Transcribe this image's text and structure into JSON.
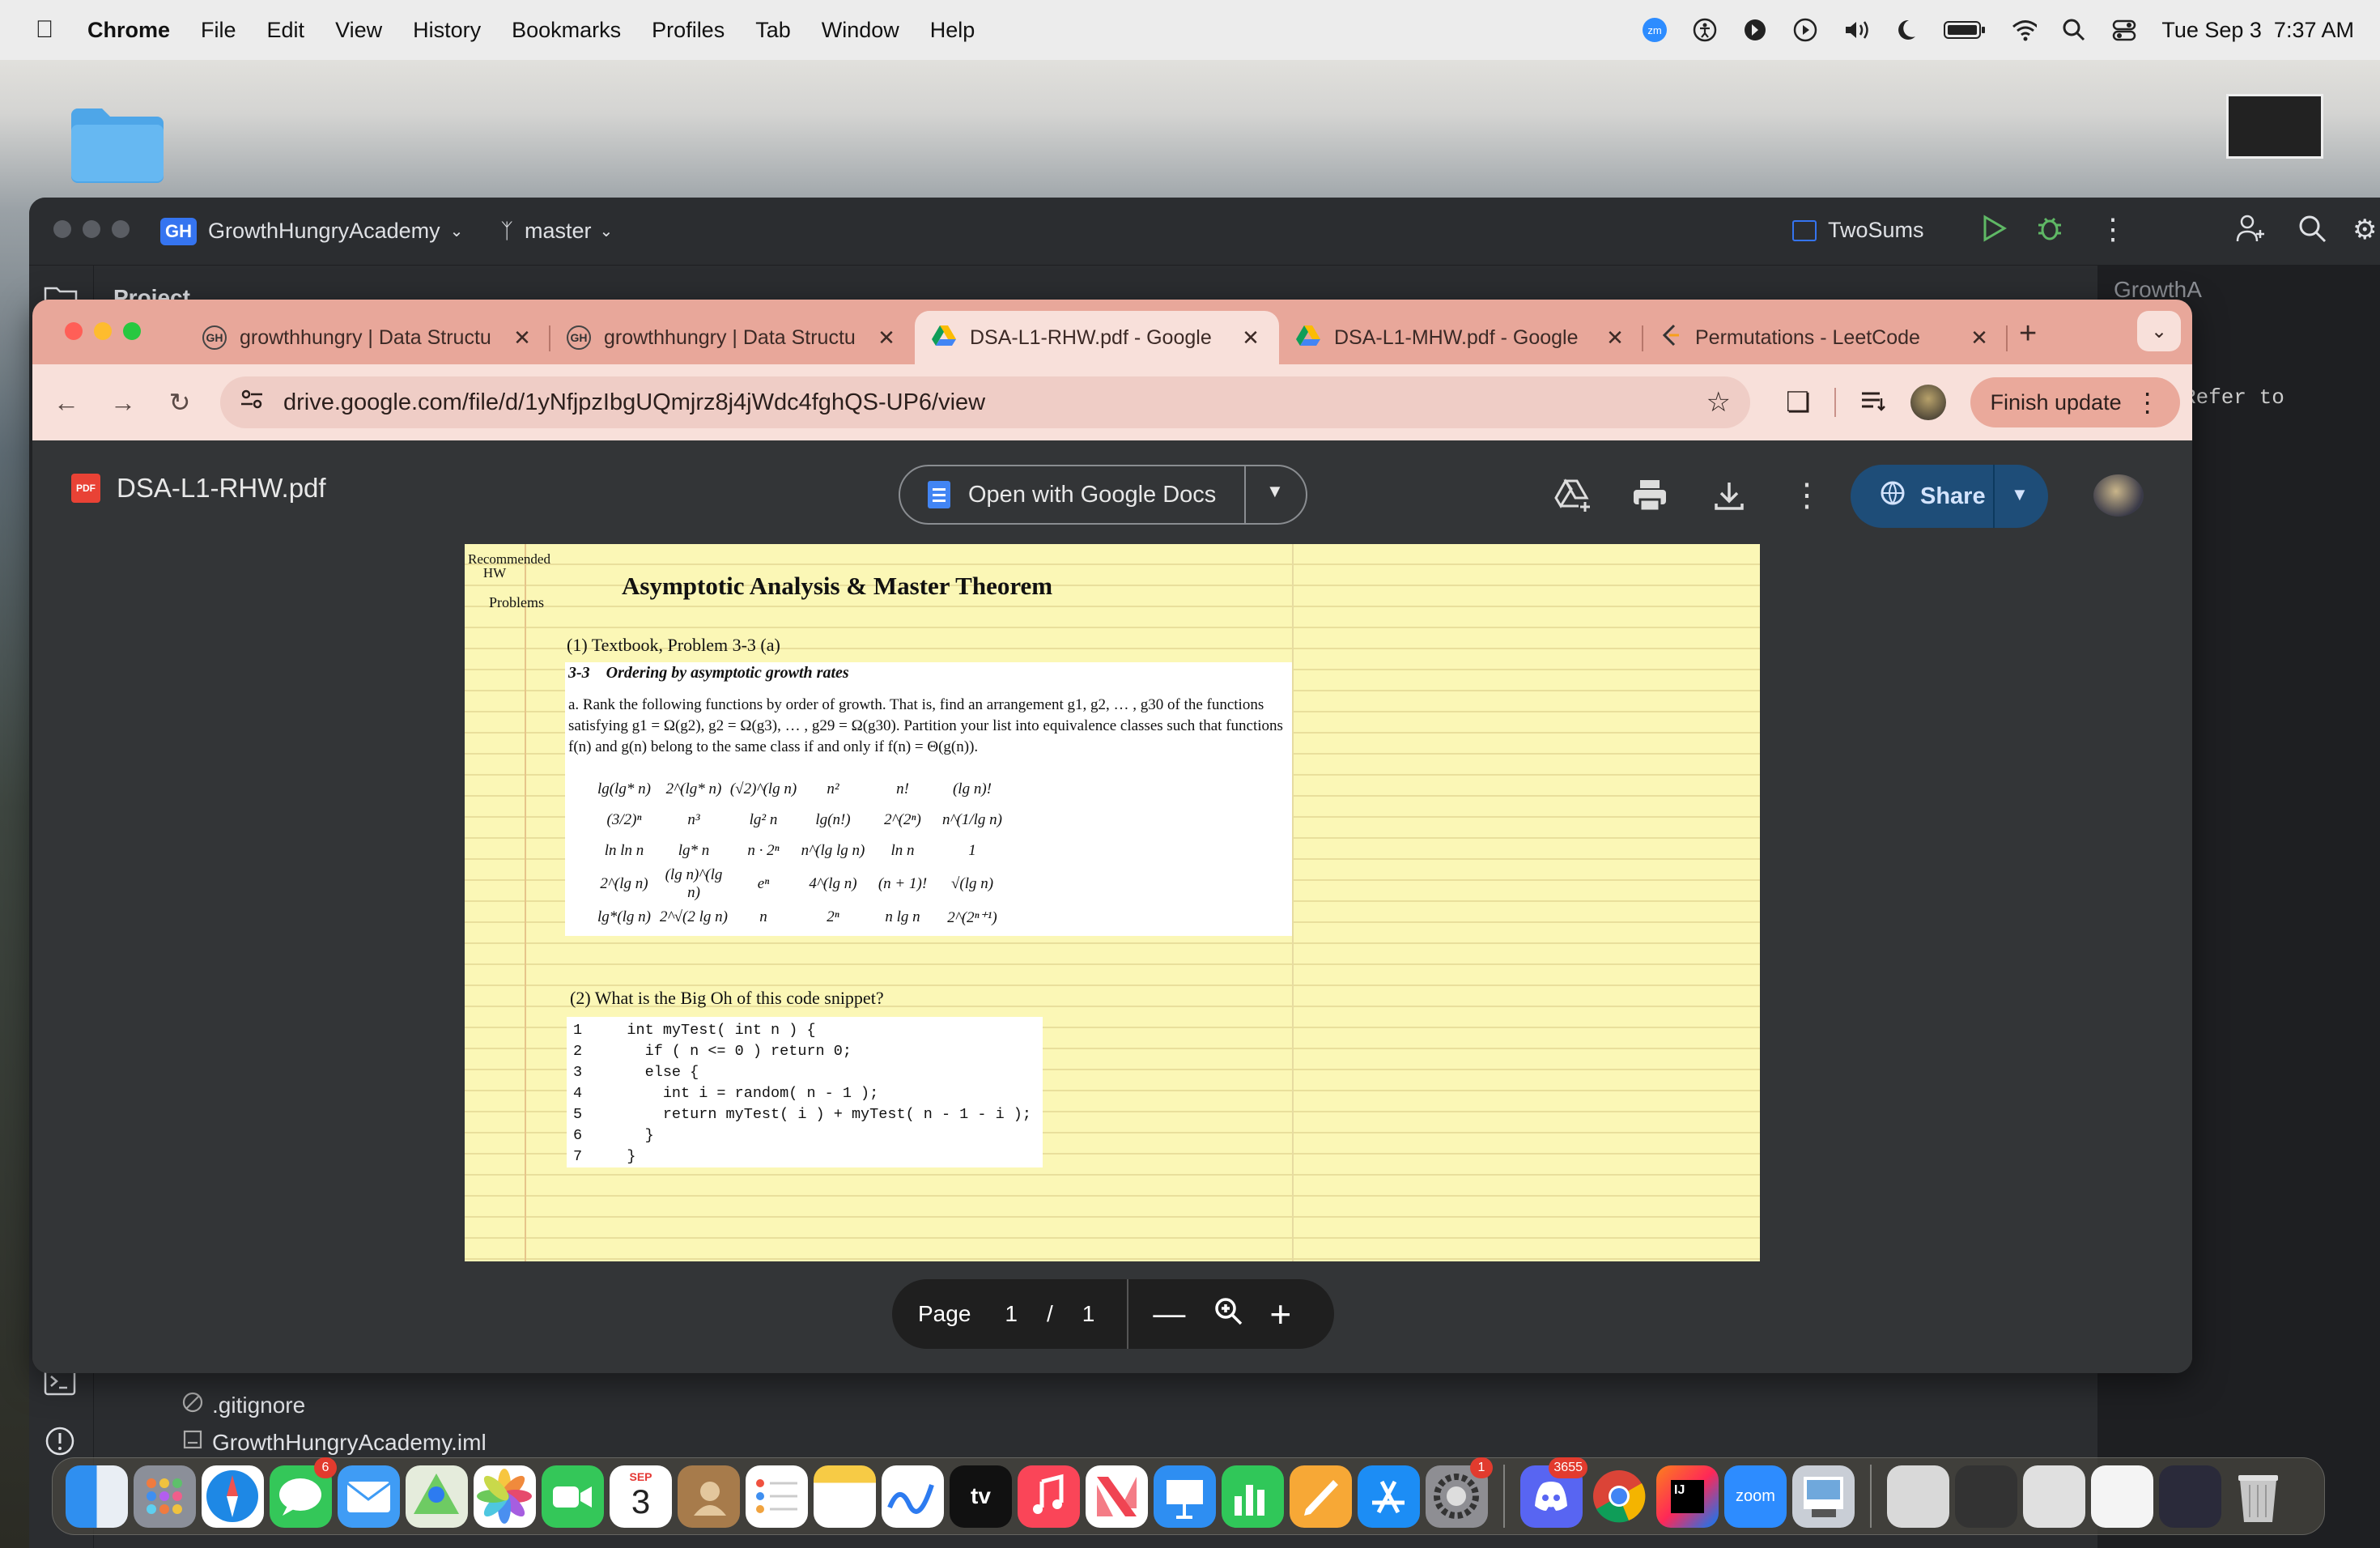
{
  "menubar": {
    "items": [
      "Chrome",
      "File",
      "Edit",
      "View",
      "History",
      "Bookmarks",
      "Profiles",
      "Tab",
      "Window",
      "Help"
    ],
    "clock": "Tue Sep 3  7:37 AM"
  },
  "ide": {
    "project_badge": "GH",
    "project": "GrowthHungryAcademy",
    "branch": "master",
    "run_config": "TwoSums",
    "project_tool": "Project",
    "right_tool": "GrowthA",
    "right_editor_hint": "Refer to",
    "tree": [
      ".gitignore",
      "GrowthHungryAcademy.iml"
    ]
  },
  "browser": {
    "tabs": [
      {
        "title": "growthhungry | Data Structu",
        "active": false
      },
      {
        "title": "growthhungry | Data Structu",
        "active": false
      },
      {
        "title": "DSA-L1-RHW.pdf - Google",
        "active": true
      },
      {
        "title": "DSA-L1-MHW.pdf - Google",
        "active": false
      },
      {
        "title": "Permutations - LeetCode",
        "active": false
      }
    ],
    "url": "drive.google.com/file/d/1yNfjpzIbgUQmjrz8j4jWdc4fghQS-UP6/view",
    "update_label": "Finish update"
  },
  "viewer": {
    "badge": "PDF",
    "filename": "DSA-L1-RHW.pdf",
    "open_with": "Open with Google Docs",
    "share": "Share",
    "page_label": "Page",
    "page_current": "1",
    "page_sep": "/",
    "page_total": "1"
  },
  "document": {
    "margin_note": "Recommended HW",
    "margin_note2": "Problems",
    "title": "Asymptotic Analysis & Master Theorem",
    "problem1": "(1) Textbook, Problem 3-3 (a)",
    "excerpt_heading": "3-3    Ordering by asymptotic growth rates",
    "excerpt_text": "a. Rank the following functions by order of growth. That is, find an arrangement g1, g2, … , g30 of the functions satisfying g1 = Ω(g2), g2 = Ω(g3), … , g29 = Ω(g30). Partition your list into equivalence classes such that functions f(n) and g(n) belong to the same class if and only if f(n) = Θ(g(n)).",
    "functions": [
      [
        "lg(lg* n)",
        "2^(lg* n)",
        "(√2)^(lg n)",
        "n²",
        "n!",
        "(lg n)!"
      ],
      [
        "(3/2)ⁿ",
        "n³",
        "lg² n",
        "lg(n!)",
        "2^(2ⁿ)",
        "n^(1/lg n)"
      ],
      [
        "ln ln n",
        "lg* n",
        "n · 2ⁿ",
        "n^(lg lg n)",
        "ln n",
        "1"
      ],
      [
        "2^(lg n)",
        "(lg n)^(lg n)",
        "eⁿ",
        "4^(lg n)",
        "(n + 1)!",
        "√(lg n)"
      ],
      [
        "lg*(lg n)",
        "2^√(2 lg n)",
        "n",
        "2ⁿ",
        "n lg n",
        "2^(2ⁿ⁺¹)"
      ]
    ],
    "problem2": "(2) What is the Big Oh of this code snippet?",
    "code": [
      {
        "n": "1",
        "text": "    int myTest( int n ) {"
      },
      {
        "n": "2",
        "text": "      if ( n <= 0 ) return 0;"
      },
      {
        "n": "3",
        "text": "      else {"
      },
      {
        "n": "4",
        "text": "        int i = random( n - 1 );"
      },
      {
        "n": "5",
        "text": "        return myTest( i ) + myTest( n - 1 - i );"
      },
      {
        "n": "6",
        "text": "      }"
      },
      {
        "n": "7",
        "text": "    }"
      }
    ]
  },
  "dock": {
    "messages_badge": "6",
    "calendar_month": "SEP",
    "calendar_day": "3",
    "settings_badge": "1",
    "discord_badge": "3655",
    "tv_label": "tv",
    "zoom_label": "zoom"
  }
}
